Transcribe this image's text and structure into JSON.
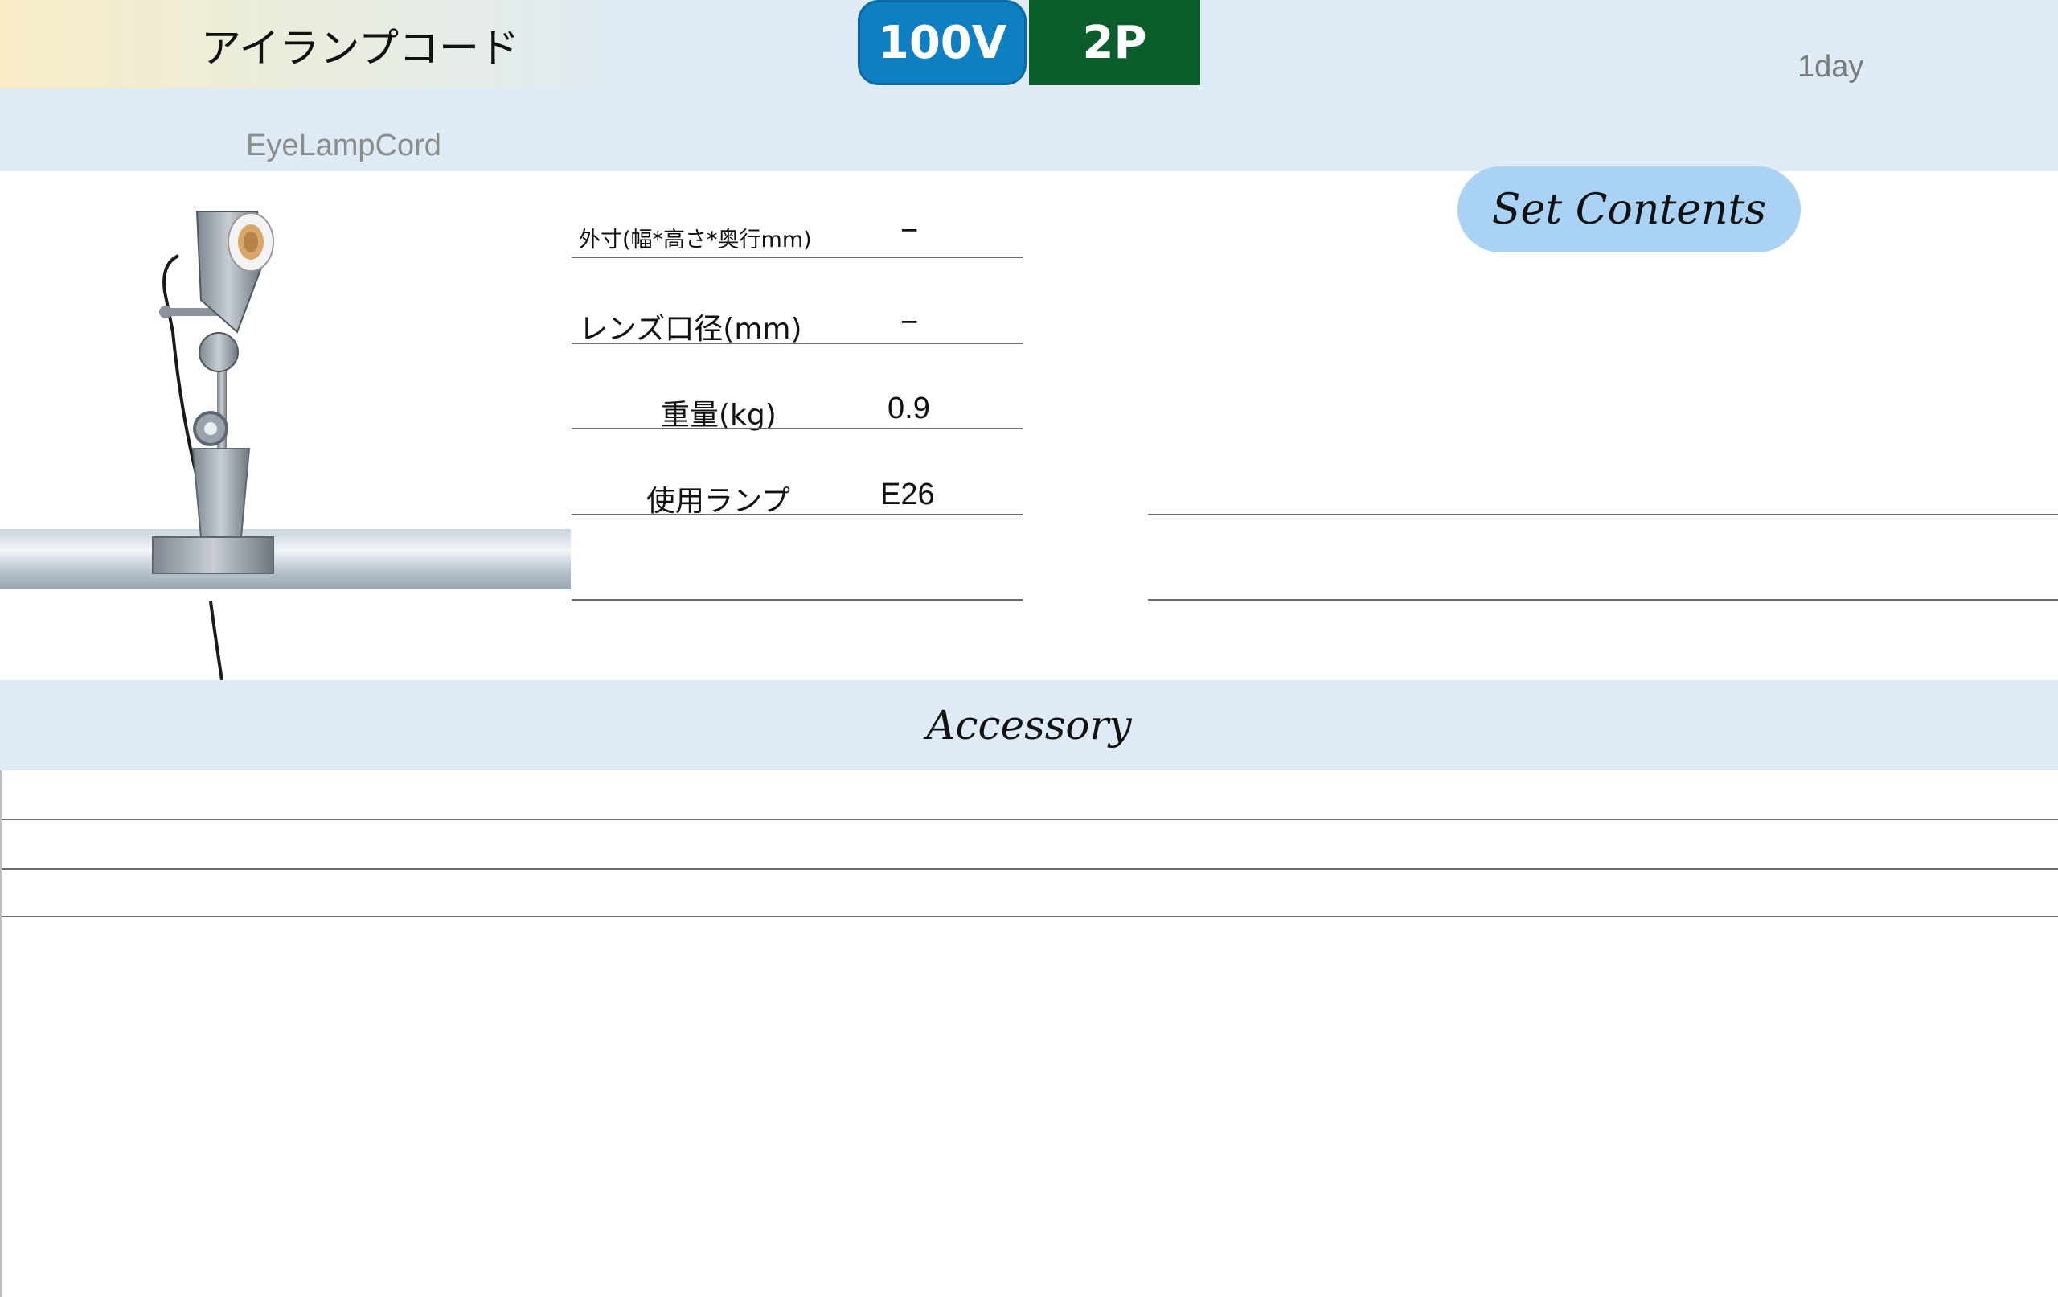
{
  "header": {
    "title_jp": "アイランプコード",
    "title_en": "EyeLampCord",
    "voltage_badge": "100V",
    "plug_badge": "2P",
    "duration": "1day",
    "colors": {
      "band": "#deeaf5",
      "voltage": "#0e7fc2",
      "plug": "#0b5e2c"
    }
  },
  "specs": [
    {
      "label": "外寸(幅*高さ*奥行mm)",
      "value": "−"
    },
    {
      "label": "レンズ口径(mm)",
      "value": "−"
    },
    {
      "label": "重量(kg)",
      "value": "0.9"
    },
    {
      "label": "使用ランプ",
      "value": "E26"
    }
  ],
  "set_contents": {
    "label": "Set Contents",
    "items": []
  },
  "accessory": {
    "label": "Accessory",
    "items": []
  }
}
